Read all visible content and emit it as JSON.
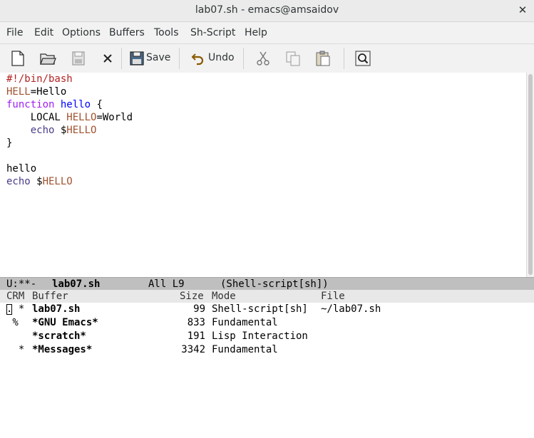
{
  "window": {
    "title": "lab07.sh - emacs@amsaidov",
    "close_glyph": "✕"
  },
  "menu": [
    "File",
    "Edit",
    "Options",
    "Buffers",
    "Tools",
    "Sh-Script",
    "Help"
  ],
  "toolbar": {
    "save_label": "Save",
    "undo_label": "Undo"
  },
  "editor": {
    "lines": [
      [
        {
          "t": "#!/bin/bash",
          "c": "c-comment"
        }
      ],
      [
        {
          "t": "HELL",
          "c": "c-var"
        },
        {
          "t": "=Hello",
          "c": ""
        }
      ],
      [
        {
          "t": "function",
          "c": "c-kw"
        },
        {
          "t": " ",
          "c": ""
        },
        {
          "t": "hello",
          "c": "c-fn"
        },
        {
          "t": " {",
          "c": ""
        }
      ],
      [
        {
          "t": "    LOCAL ",
          "c": ""
        },
        {
          "t": "HELLO",
          "c": "c-var"
        },
        {
          "t": "=World",
          "c": ""
        }
      ],
      [
        {
          "t": "    ",
          "c": ""
        },
        {
          "t": "echo",
          "c": "c-builtin"
        },
        {
          "t": " $",
          "c": ""
        },
        {
          "t": "HELLO",
          "c": "c-var"
        }
      ],
      [
        {
          "t": "}",
          "c": ""
        }
      ],
      [
        {
          "t": "",
          "c": ""
        }
      ],
      [
        {
          "t": "hello",
          "c": ""
        }
      ],
      [
        {
          "t": "echo",
          "c": "c-builtin"
        },
        {
          "t": " $",
          "c": ""
        },
        {
          "t": "HELLO",
          "c": "c-var"
        }
      ]
    ]
  },
  "modeline": {
    "status": "U:**-",
    "buffer_name": "lab07.sh",
    "position": "All L9",
    "mode": "(Shell-script[sh])"
  },
  "buffer_list": {
    "headers": {
      "crm": "CRM",
      "buffer": "Buffer",
      "size": "Size",
      "mode": "Mode",
      "file": "File"
    },
    "rows": [
      {
        "crm": ". *",
        "buffer": "lab07.sh",
        "size": "99",
        "mode": "Shell-script[sh]",
        "file": "~/lab07.sh"
      },
      {
        "crm": " %",
        "buffer": "*GNU Emacs*",
        "size": "833",
        "mode": "Fundamental",
        "file": ""
      },
      {
        "crm": "",
        "buffer": "*scratch*",
        "size": "191",
        "mode": "Lisp Interaction",
        "file": ""
      },
      {
        "crm": "  *",
        "buffer": "*Messages*",
        "size": "3342",
        "mode": "Fundamental",
        "file": ""
      }
    ]
  }
}
